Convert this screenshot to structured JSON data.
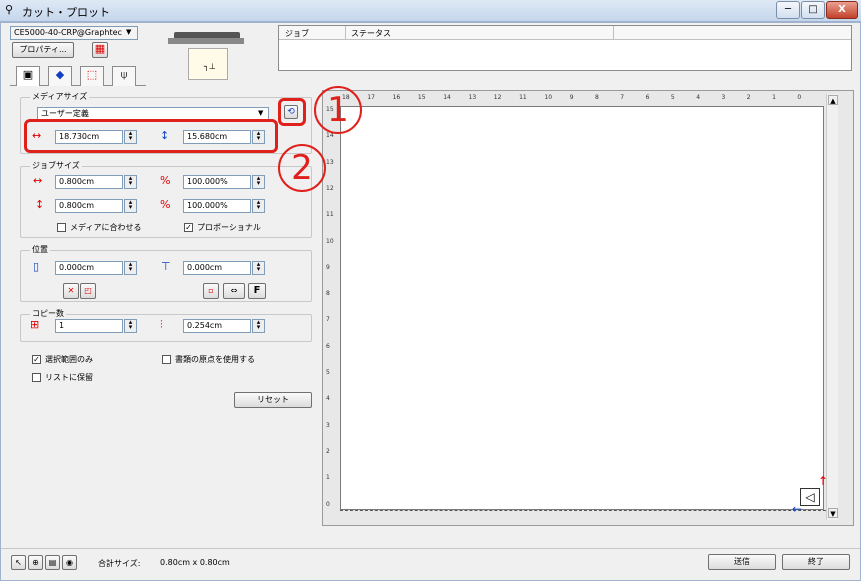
{
  "window": {
    "title": "カット・プロット",
    "minimize": "─",
    "maximize": "□",
    "close": "X"
  },
  "device": {
    "name": "CE5000-40-CRP@Graphtec",
    "properties_label": "プロパティ..."
  },
  "job_table": {
    "col_job": "ジョブ",
    "col_status": "ステータス"
  },
  "media_size": {
    "label": "メディアサイズ",
    "preset": "ユーザー定義",
    "width": "18.730cm",
    "height": "15.680cm"
  },
  "job_size": {
    "label": "ジョブサイズ",
    "width": "0.800cm",
    "height": "0.800cm",
    "scale_x": "100.000%",
    "scale_y": "100.000%",
    "fit_media_label": "メディアに合わせる",
    "fit_media_checked": false,
    "proportional_label": "プロポーショナル",
    "proportional_checked": true
  },
  "position": {
    "label": "位置",
    "x": "0.000cm",
    "y": "0.000cm",
    "f_button": "F"
  },
  "copies": {
    "label": "コピー数",
    "count": "1",
    "spacing": "0.254cm"
  },
  "options": {
    "selection_only_label": "選択範囲のみ",
    "selection_only_checked": true,
    "doc_origin_label": "書類の原点を使用する",
    "doc_origin_checked": false,
    "keep_in_list_label": "リストに保留",
    "keep_in_list_checked": false,
    "reset_label": "リセット"
  },
  "ruler": {
    "top_ticks": [
      "18",
      "17",
      "16",
      "15",
      "14",
      "13",
      "12",
      "11",
      "10",
      "9",
      "8",
      "7",
      "6",
      "5",
      "4",
      "3",
      "2",
      "1",
      "0"
    ],
    "left_ticks": [
      "15",
      "14",
      "13",
      "12",
      "11",
      "10",
      "9",
      "8",
      "7",
      "6",
      "5",
      "4",
      "3",
      "2",
      "1",
      "0"
    ]
  },
  "annotations": {
    "one": "1",
    "two": "2",
    "color": "#e0201a"
  },
  "status_bar": {
    "total_size_label": "合計サイズ:",
    "total_size_value": "0.80cm x 0.80cm",
    "send_label": "送信",
    "exit_label": "終了"
  }
}
